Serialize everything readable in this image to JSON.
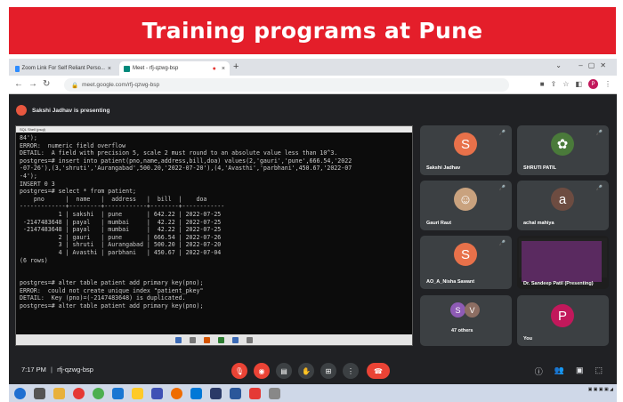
{
  "banner": {
    "title": "Training programs at Pune"
  },
  "browser": {
    "tabs": [
      {
        "label": "Zoom Link For Self Reliant Perso...",
        "close": "×"
      },
      {
        "label": "Meet - rfj-qzwg-bsp",
        "close": "×"
      }
    ],
    "new_tab": "+",
    "url": "meet.google.com/rfj-qzwg-bsp",
    "profile_initial": "P"
  },
  "presenting": {
    "text": "Sakshi Jadhav is presenting"
  },
  "terminal": {
    "title": "SQL Shell (psql)",
    "lines": [
      "84');",
      "ERROR:  numeric field overflow",
      "DETAIL:  A field with precision 5, scale 2 must round to an absolute value less than 10^3.",
      "postgres=# insert into patient(pno,name,address,bill,doa) values(2,'gauri','pune',666.54,'2022",
      "-07-26'),(3,'shruti','Aurangabad',500.20,'2022-07-20'),(4,'Avasthi','parbhani',450.67,'2022-07",
      "-4');",
      "INSERT 0 3",
      "postgres=# select * from patient;",
      "    pno      |  name   |  address   |  bill  |    doa",
      "-------------+---------+------------+--------+------------",
      "           1 | sakshi  | pune       | 642.22 | 2022-07-25",
      " -2147483648 | payal   | mumbai     |  42.22 | 2022-07-25",
      " -2147483648 | payal   | mumbai     |  42.22 | 2022-07-25",
      "           2 | gauri   | pune       | 666.54 | 2022-07-26",
      "           3 | shruti  | Aurangabad | 500.20 | 2022-07-20",
      "           4 | Avasthi | parbhani   | 450.67 | 2022-07-04",
      "(6 rows)",
      "",
      "",
      "postgres=# alter table patient add primary key(pno);",
      "ERROR:  could not create unique index \"patient_pkey\"",
      "DETAIL:  Key (pno)=(-2147483648) is duplicated.",
      "postgres=# alter table patient add primary key(pno);"
    ]
  },
  "participants": [
    {
      "name": "Sakshi Jadhav",
      "initial": "S",
      "color": "#e8714a"
    },
    {
      "name": "SHRUTI PATIL",
      "initial": "",
      "color": "#4a7a3a"
    },
    {
      "name": "Gauri Raut",
      "initial": "",
      "color": "#c9a27e"
    },
    {
      "name": "achal mahiya",
      "initial": "a",
      "color": "#6d4c41"
    },
    {
      "name": "AO_A_Nisha Sawant",
      "initial": "S",
      "color": "#e8714a"
    },
    {
      "name": "Dr. Sandeep Patil (Presenting)",
      "initial": "",
      "color": "#222"
    },
    {
      "name": "47 others",
      "initial": "",
      "color": "#3c4043"
    },
    {
      "name": "You",
      "initial": "P",
      "color": "#c2185b"
    }
  ],
  "others_avatars": [
    "S",
    "V"
  ],
  "meeting": {
    "time": "7:17 PM",
    "separator": "|",
    "code": "rfj-qzwg-bsp"
  }
}
